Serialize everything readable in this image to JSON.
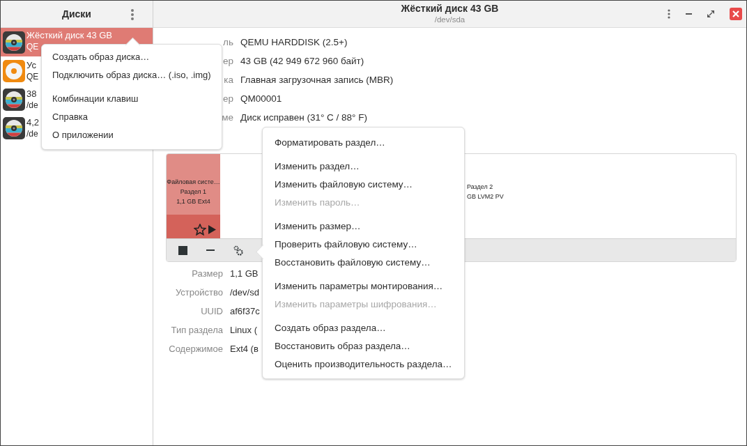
{
  "sidebar": {
    "title": "Диски",
    "disks": [
      {
        "name": "Жёсткий диск 43 GB",
        "detail": "QE",
        "kind": "hdd",
        "selected": true
      },
      {
        "name": "Ус",
        "detail": "QE",
        "kind": "optical",
        "selected": false
      },
      {
        "name": "38",
        "detail": "/de",
        "kind": "hdd",
        "selected": false
      },
      {
        "name": "4,2",
        "detail": "/de",
        "kind": "hdd",
        "selected": false
      }
    ]
  },
  "app_menu": {
    "groups": [
      [
        "Создать образ диска…",
        "Подключить образ диска… (.iso, .img)"
      ],
      [
        "Комбинации клавиш",
        "Справка",
        "О приложении"
      ]
    ]
  },
  "header": {
    "title": "Жёсткий диск 43 GB",
    "subtitle": "/dev/sda"
  },
  "drive_info": [
    {
      "label": "ль",
      "value": "QEMU HARDDISK (2.5+)"
    },
    {
      "label": "ер",
      "value": "43 GB (42 949 672 960 байт)"
    },
    {
      "label": "ка",
      "value": "Главная загрузочная запись (MBR)"
    },
    {
      "label": "ер",
      "value": "QM00001"
    },
    {
      "label": "ме",
      "value": "Диск исправен (31° C / 88° F)"
    }
  ],
  "volumes": {
    "partitions": [
      {
        "lines": [
          "Файловая систе…",
          "Раздел 1",
          "1,1 GB Ext4"
        ],
        "selected": true
      },
      {
        "lines": [
          "Раздел 2",
          "GB LVM2 PV"
        ],
        "selected": false
      }
    ]
  },
  "partition_info": [
    {
      "label": "Размер",
      "value": "1,1 GB"
    },
    {
      "label": "Устройство",
      "value": "/dev/sd"
    },
    {
      "label": "UUID",
      "value": "af6f37c"
    },
    {
      "label": "Тип раздела",
      "value": "Linux ("
    },
    {
      "label": "Содержимое",
      "value": "Ext4 (в"
    }
  ],
  "context_menu": {
    "groups": [
      [
        {
          "label": "Форматировать раздел…",
          "disabled": false
        }
      ],
      [
        {
          "label": "Изменить раздел…",
          "disabled": false
        },
        {
          "label": "Изменить файловую систему…",
          "disabled": false
        },
        {
          "label": "Изменить пароль…",
          "disabled": true
        }
      ],
      [
        {
          "label": "Изменить размер…",
          "disabled": false
        },
        {
          "label": "Проверить файловую систему…",
          "disabled": false
        },
        {
          "label": "Восстановить файловую систему…",
          "disabled": false
        }
      ],
      [
        {
          "label": "Изменить параметры монтирования…",
          "disabled": false
        },
        {
          "label": "Изменить параметры шифрования…",
          "disabled": true
        }
      ],
      [
        {
          "label": "Создать образ раздела…",
          "disabled": false
        },
        {
          "label": "Восстановить образ раздела…",
          "disabled": false
        },
        {
          "label": "Оценить производительность раздела…",
          "disabled": false
        }
      ]
    ]
  }
}
